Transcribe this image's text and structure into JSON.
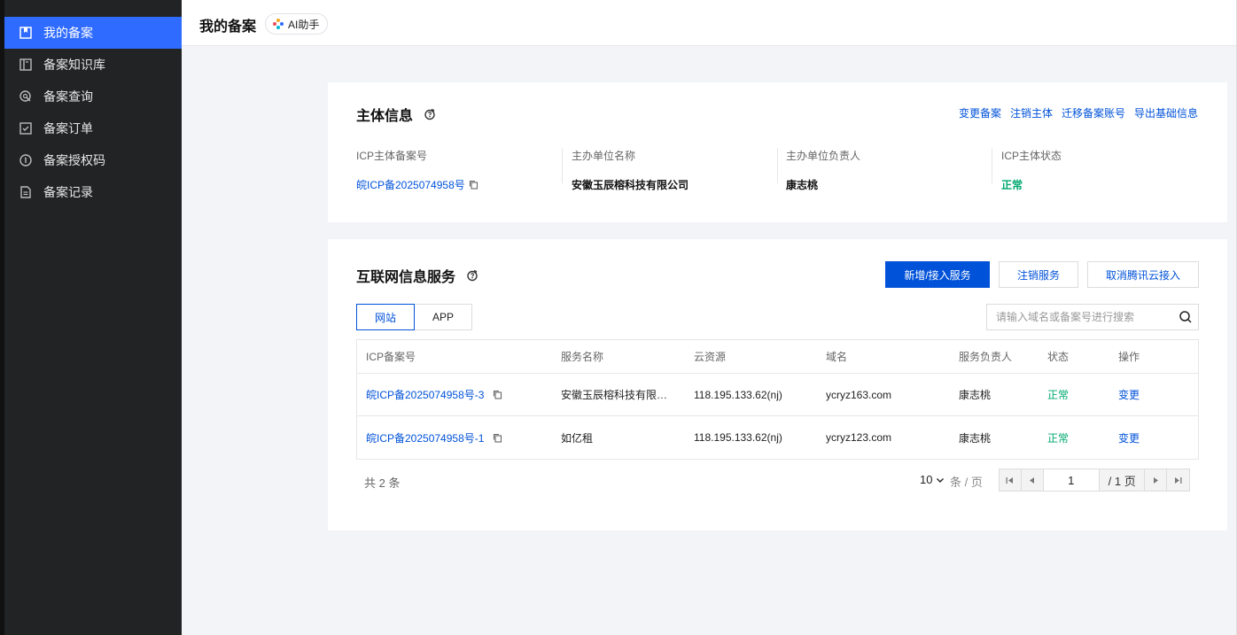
{
  "sidebar": {
    "items": [
      {
        "label": "我的备案",
        "icon": "bookmark-icon",
        "active": true
      },
      {
        "label": "备案知识库",
        "icon": "book-icon",
        "active": false
      },
      {
        "label": "备案查询",
        "icon": "search-doc-icon",
        "active": false
      },
      {
        "label": "备案订单",
        "icon": "order-check-icon",
        "active": false
      },
      {
        "label": "备案授权码",
        "icon": "auth-code-icon",
        "active": false
      },
      {
        "label": "备案记录",
        "icon": "record-icon",
        "active": false
      }
    ]
  },
  "header": {
    "title": "我的备案",
    "ai_label": "AI助手"
  },
  "subject": {
    "title": "主体信息",
    "links": [
      "变更备案",
      "注销主体",
      "迁移备案账号",
      "导出基础信息"
    ],
    "fields": [
      {
        "label": "ICP主体备案号",
        "value": "皖ICP备2025074958号"
      },
      {
        "label": "主办单位名称",
        "value": "安徽玉辰榕科技有限公司"
      },
      {
        "label": "主办单位负责人",
        "value": "康志桃"
      },
      {
        "label": "ICP主体状态",
        "value": "正常"
      }
    ]
  },
  "service": {
    "title": "互联网信息服务",
    "buttons": {
      "add": "新增/接入服务",
      "cancel": "注销服务",
      "cancel_access": "取消腾讯云接入"
    },
    "tabs": [
      "网站",
      "APP"
    ],
    "search_placeholder": "请输入域名或备案号进行搜索",
    "columns": [
      "ICP备案号",
      "服务名称",
      "云资源",
      "域名",
      "服务负责人",
      "状态",
      "操作"
    ],
    "rows": [
      {
        "icp": "皖ICP备2025074958号-3",
        "name": "安徽玉辰榕科技有限公司",
        "cloud": "118.195.133.62(nj)",
        "domain": "ycryz163.com",
        "owner": "康志桃",
        "status": "正常",
        "action": "变更"
      },
      {
        "icp": "皖ICP备2025074958号-1",
        "name": "如亿租",
        "cloud": "118.195.133.62(nj)",
        "domain": "ycryz123.com",
        "owner": "康志桃",
        "status": "正常",
        "action": "变更"
      }
    ],
    "total": "共 2 条",
    "page_size": "10",
    "per_page_label": "条 / 页",
    "current_page": "1",
    "total_pages": "/ 1 页"
  },
  "colors": {
    "sidebar_bg": "#222324",
    "accent": "#2f6bff",
    "link": "#0052d9",
    "success": "#00a870"
  }
}
